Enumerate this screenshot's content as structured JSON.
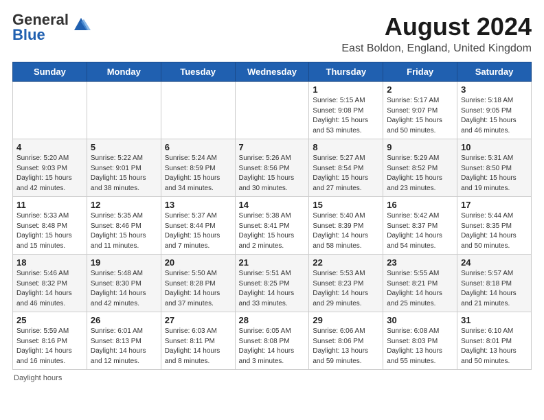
{
  "header": {
    "logo_general": "General",
    "logo_blue": "Blue",
    "month_title": "August 2024",
    "location": "East Boldon, England, United Kingdom"
  },
  "weekdays": [
    "Sunday",
    "Monday",
    "Tuesday",
    "Wednesday",
    "Thursday",
    "Friday",
    "Saturday"
  ],
  "weeks": [
    [
      {
        "day": "",
        "info": ""
      },
      {
        "day": "",
        "info": ""
      },
      {
        "day": "",
        "info": ""
      },
      {
        "day": "",
        "info": ""
      },
      {
        "day": "1",
        "info": "Sunrise: 5:15 AM\nSunset: 9:08 PM\nDaylight: 15 hours\nand 53 minutes."
      },
      {
        "day": "2",
        "info": "Sunrise: 5:17 AM\nSunset: 9:07 PM\nDaylight: 15 hours\nand 50 minutes."
      },
      {
        "day": "3",
        "info": "Sunrise: 5:18 AM\nSunset: 9:05 PM\nDaylight: 15 hours\nand 46 minutes."
      }
    ],
    [
      {
        "day": "4",
        "info": "Sunrise: 5:20 AM\nSunset: 9:03 PM\nDaylight: 15 hours\nand 42 minutes."
      },
      {
        "day": "5",
        "info": "Sunrise: 5:22 AM\nSunset: 9:01 PM\nDaylight: 15 hours\nand 38 minutes."
      },
      {
        "day": "6",
        "info": "Sunrise: 5:24 AM\nSunset: 8:59 PM\nDaylight: 15 hours\nand 34 minutes."
      },
      {
        "day": "7",
        "info": "Sunrise: 5:26 AM\nSunset: 8:56 PM\nDaylight: 15 hours\nand 30 minutes."
      },
      {
        "day": "8",
        "info": "Sunrise: 5:27 AM\nSunset: 8:54 PM\nDaylight: 15 hours\nand 27 minutes."
      },
      {
        "day": "9",
        "info": "Sunrise: 5:29 AM\nSunset: 8:52 PM\nDaylight: 15 hours\nand 23 minutes."
      },
      {
        "day": "10",
        "info": "Sunrise: 5:31 AM\nSunset: 8:50 PM\nDaylight: 15 hours\nand 19 minutes."
      }
    ],
    [
      {
        "day": "11",
        "info": "Sunrise: 5:33 AM\nSunset: 8:48 PM\nDaylight: 15 hours\nand 15 minutes."
      },
      {
        "day": "12",
        "info": "Sunrise: 5:35 AM\nSunset: 8:46 PM\nDaylight: 15 hours\nand 11 minutes."
      },
      {
        "day": "13",
        "info": "Sunrise: 5:37 AM\nSunset: 8:44 PM\nDaylight: 15 hours\nand 7 minutes."
      },
      {
        "day": "14",
        "info": "Sunrise: 5:38 AM\nSunset: 8:41 PM\nDaylight: 15 hours\nand 2 minutes."
      },
      {
        "day": "15",
        "info": "Sunrise: 5:40 AM\nSunset: 8:39 PM\nDaylight: 14 hours\nand 58 minutes."
      },
      {
        "day": "16",
        "info": "Sunrise: 5:42 AM\nSunset: 8:37 PM\nDaylight: 14 hours\nand 54 minutes."
      },
      {
        "day": "17",
        "info": "Sunrise: 5:44 AM\nSunset: 8:35 PM\nDaylight: 14 hours\nand 50 minutes."
      }
    ],
    [
      {
        "day": "18",
        "info": "Sunrise: 5:46 AM\nSunset: 8:32 PM\nDaylight: 14 hours\nand 46 minutes."
      },
      {
        "day": "19",
        "info": "Sunrise: 5:48 AM\nSunset: 8:30 PM\nDaylight: 14 hours\nand 42 minutes."
      },
      {
        "day": "20",
        "info": "Sunrise: 5:50 AM\nSunset: 8:28 PM\nDaylight: 14 hours\nand 37 minutes."
      },
      {
        "day": "21",
        "info": "Sunrise: 5:51 AM\nSunset: 8:25 PM\nDaylight: 14 hours\nand 33 minutes."
      },
      {
        "day": "22",
        "info": "Sunrise: 5:53 AM\nSunset: 8:23 PM\nDaylight: 14 hours\nand 29 minutes."
      },
      {
        "day": "23",
        "info": "Sunrise: 5:55 AM\nSunset: 8:21 PM\nDaylight: 14 hours\nand 25 minutes."
      },
      {
        "day": "24",
        "info": "Sunrise: 5:57 AM\nSunset: 8:18 PM\nDaylight: 14 hours\nand 21 minutes."
      }
    ],
    [
      {
        "day": "25",
        "info": "Sunrise: 5:59 AM\nSunset: 8:16 PM\nDaylight: 14 hours\nand 16 minutes."
      },
      {
        "day": "26",
        "info": "Sunrise: 6:01 AM\nSunset: 8:13 PM\nDaylight: 14 hours\nand 12 minutes."
      },
      {
        "day": "27",
        "info": "Sunrise: 6:03 AM\nSunset: 8:11 PM\nDaylight: 14 hours\nand 8 minutes."
      },
      {
        "day": "28",
        "info": "Sunrise: 6:05 AM\nSunset: 8:08 PM\nDaylight: 14 hours\nand 3 minutes."
      },
      {
        "day": "29",
        "info": "Sunrise: 6:06 AM\nSunset: 8:06 PM\nDaylight: 13 hours\nand 59 minutes."
      },
      {
        "day": "30",
        "info": "Sunrise: 6:08 AM\nSunset: 8:03 PM\nDaylight: 13 hours\nand 55 minutes."
      },
      {
        "day": "31",
        "info": "Sunrise: 6:10 AM\nSunset: 8:01 PM\nDaylight: 13 hours\nand 50 minutes."
      }
    ]
  ],
  "footer": {
    "daylight_label": "Daylight hours"
  }
}
